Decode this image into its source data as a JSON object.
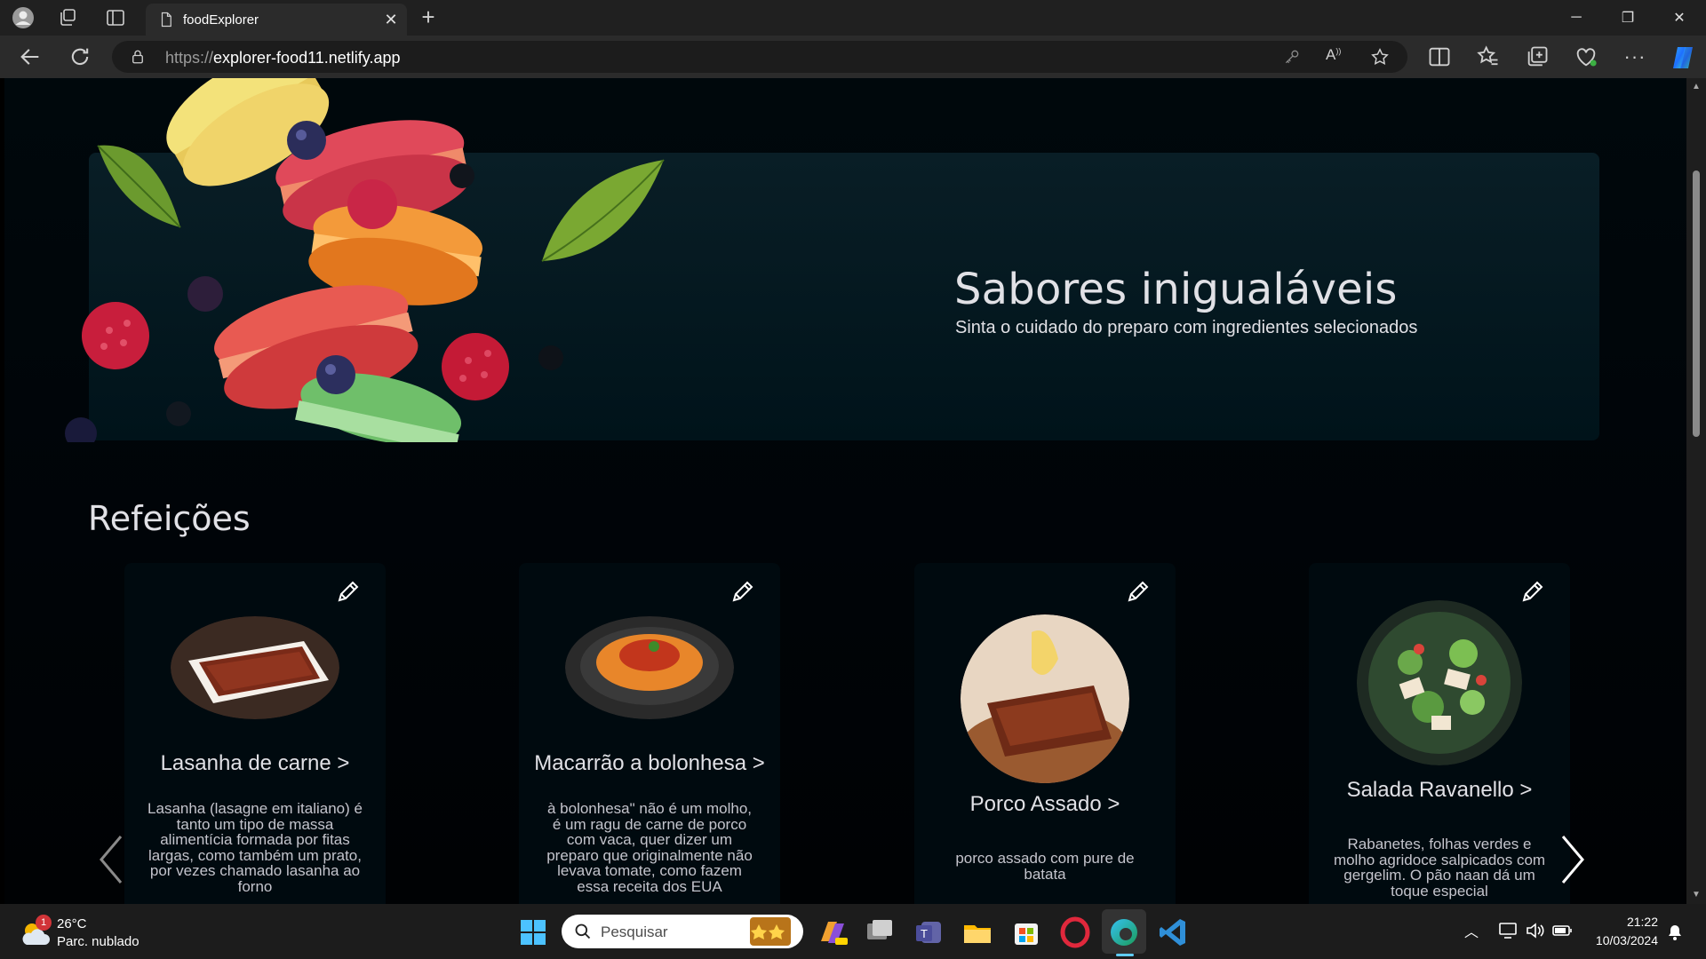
{
  "browser": {
    "tab_title": "foodExplorer",
    "url_protocol": "https://",
    "url_host": "explorer-food11.netlify.app"
  },
  "banner": {
    "title": "Sabores inigualáveis",
    "subtitle": "Sinta o cuidado do preparo com ingredientes selecionados"
  },
  "section": {
    "title": "Refeições"
  },
  "dishes": [
    {
      "name": "Lasanha de carne >",
      "description": "Lasanha (lasagne em italiano) é tanto um tipo de massa alimentícia formada por fitas largas, como também um prato, por vezes chamado lasanha ao forno",
      "image": "lasagna-dish"
    },
    {
      "name": "Macarrão a bolonhesa >",
      "description": "à bolonhesa\" não é um molho, é um ragu de carne de porco com vaca, quer dizer um preparo que originalmente não levava tomate, como fazem essa receita dos EUA",
      "image": "spaghetti-dish"
    },
    {
      "name": "Porco Assado >",
      "description": "porco assado com pure de batata",
      "image": "roast-pork-dish"
    },
    {
      "name": "Salada Ravanello >",
      "description": "Rabanetes, folhas verdes e molho agridoce salpicados com gergelim. O pão naan dá um toque especial",
      "image": "salad-dish"
    }
  ],
  "taskbar": {
    "weather_badge": "1",
    "weather_temp": "26°C",
    "weather_desc": "Parc. nublado",
    "search_placeholder": "Pesquisar",
    "time": "21:22",
    "date": "10/03/2024"
  },
  "colors": {
    "page_bg": "#000a0f",
    "banner_bg": "#00131a",
    "text_primary": "#e1e1e6",
    "text_secondary": "#c4c4cc"
  }
}
